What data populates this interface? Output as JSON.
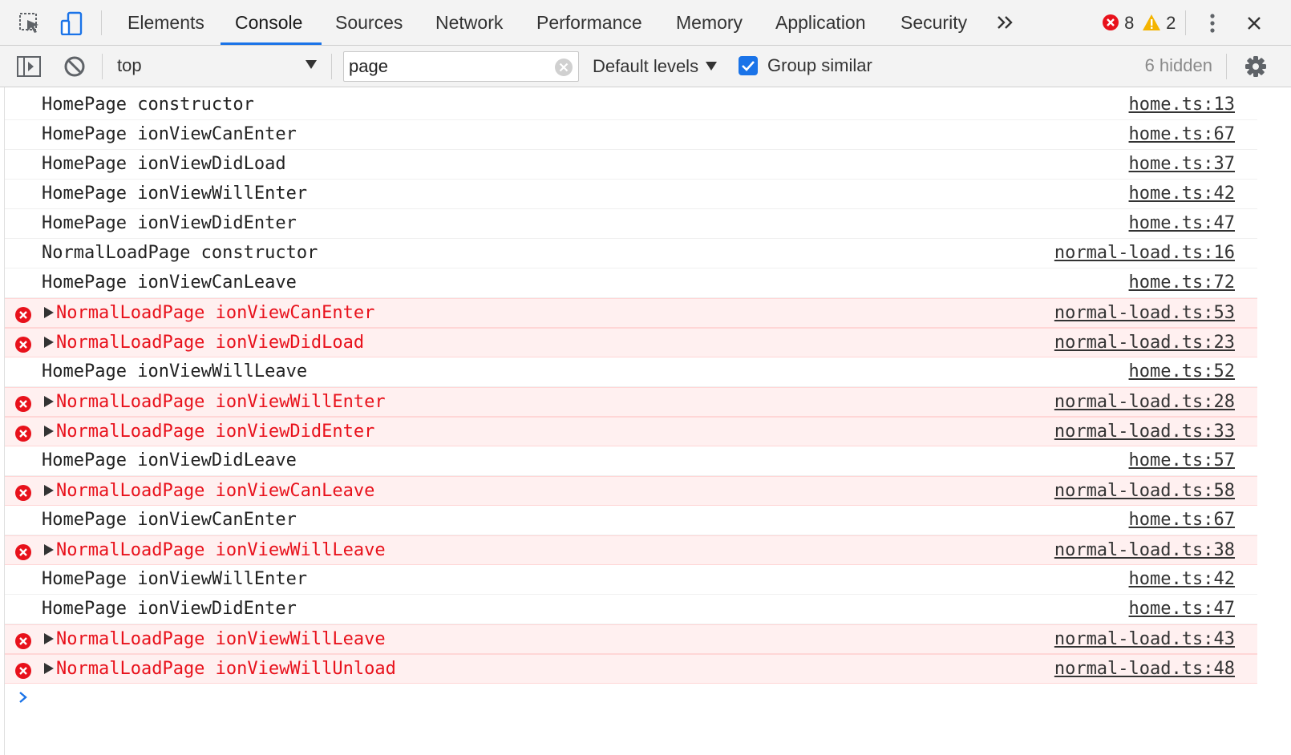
{
  "tabs": [
    {
      "label": "Elements"
    },
    {
      "label": "Console"
    },
    {
      "label": "Sources"
    },
    {
      "label": "Network"
    },
    {
      "label": "Performance"
    },
    {
      "label": "Memory"
    },
    {
      "label": "Application"
    },
    {
      "label": "Security"
    }
  ],
  "active_tab": "Console",
  "counters": {
    "errors": "8",
    "warnings": "2"
  },
  "toolbar": {
    "context": "top",
    "filter_value": "page",
    "levels_label": "Default levels",
    "group_similar_label": "Group similar",
    "group_similar_checked": true,
    "hidden_label": "6 hidden"
  },
  "colors": {
    "accent": "#1a73e8",
    "error_text": "#e8111b",
    "error_bg": "#fff0f0",
    "warning": "#f4b400"
  },
  "messages": [
    {
      "level": "log",
      "text": "HomePage constructor",
      "source": "home.ts:13"
    },
    {
      "level": "log",
      "text": "HomePage ionViewCanEnter",
      "source": "home.ts:67"
    },
    {
      "level": "log",
      "text": "HomePage ionViewDidLoad",
      "source": "home.ts:37"
    },
    {
      "level": "log",
      "text": "HomePage ionViewWillEnter",
      "source": "home.ts:42"
    },
    {
      "level": "log",
      "text": "HomePage ionViewDidEnter",
      "source": "home.ts:47"
    },
    {
      "level": "log",
      "text": "NormalLoadPage constructor",
      "source": "normal-load.ts:16"
    },
    {
      "level": "log",
      "text": "HomePage ionViewCanLeave",
      "source": "home.ts:72"
    },
    {
      "level": "error",
      "text": "NormalLoadPage ionViewCanEnter",
      "source": "normal-load.ts:53"
    },
    {
      "level": "error",
      "text": "NormalLoadPage ionViewDidLoad",
      "source": "normal-load.ts:23"
    },
    {
      "level": "log",
      "text": "HomePage ionViewWillLeave",
      "source": "home.ts:52"
    },
    {
      "level": "error",
      "text": "NormalLoadPage ionViewWillEnter",
      "source": "normal-load.ts:28"
    },
    {
      "level": "error",
      "text": "NormalLoadPage ionViewDidEnter",
      "source": "normal-load.ts:33"
    },
    {
      "level": "log",
      "text": "HomePage ionViewDidLeave",
      "source": "home.ts:57"
    },
    {
      "level": "error",
      "text": "NormalLoadPage ionViewCanLeave",
      "source": "normal-load.ts:58"
    },
    {
      "level": "log",
      "text": "HomePage ionViewCanEnter",
      "source": "home.ts:67"
    },
    {
      "level": "error",
      "text": "NormalLoadPage ionViewWillLeave",
      "source": "normal-load.ts:38"
    },
    {
      "level": "log",
      "text": "HomePage ionViewWillEnter",
      "source": "home.ts:42"
    },
    {
      "level": "log",
      "text": "HomePage ionViewDidEnter",
      "source": "home.ts:47"
    },
    {
      "level": "error",
      "text": "NormalLoadPage ionViewWillLeave",
      "source": "normal-load.ts:43"
    },
    {
      "level": "error",
      "text": "NormalLoadPage ionViewWillUnload",
      "source": "normal-load.ts:48"
    }
  ]
}
